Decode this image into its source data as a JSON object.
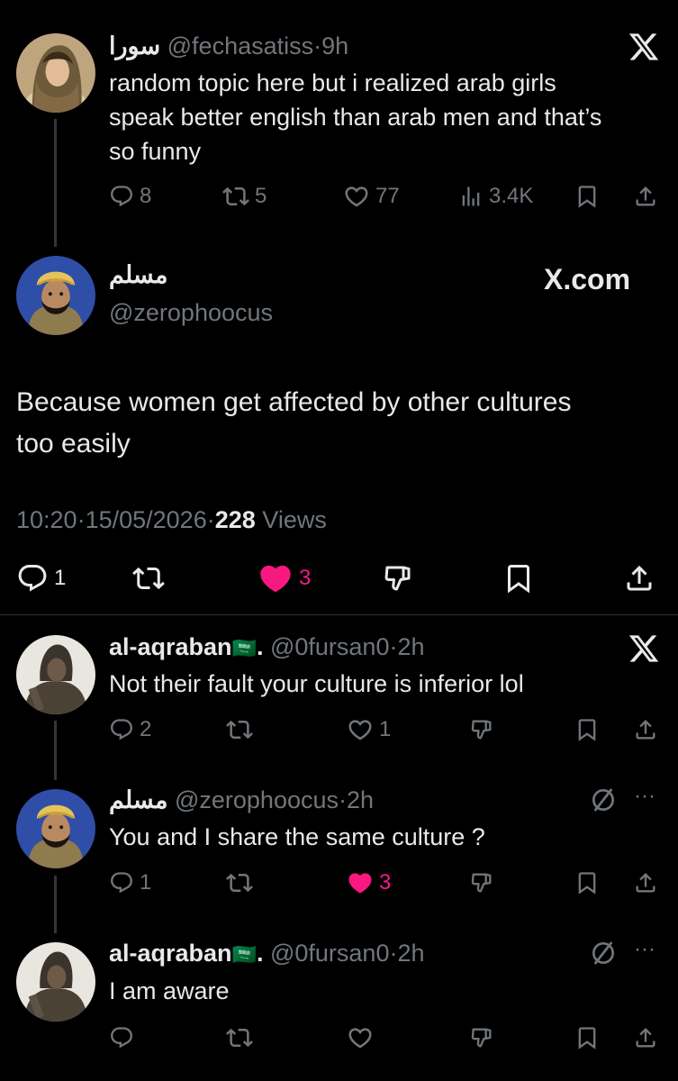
{
  "quoted": {
    "display_name": "سورا",
    "handle": "@fechasatiss",
    "separator": "·",
    "time": "9h",
    "text_lines": [
      "random topic here but i realized arab girls",
      "speak better english than arab men and that’s",
      "so funny"
    ],
    "replies": "8",
    "reposts": "5",
    "likes": "77",
    "views": "3.4K"
  },
  "main": {
    "display_name": "مسلم",
    "handle": "@zerophoocus",
    "source_label": "X.com",
    "text_lines": [
      "Because women get affected by other cultures",
      "too easily"
    ],
    "time": "10:20",
    "date": "15/05/2026",
    "views_count": "228",
    "views_label": "Views",
    "replies": "1",
    "likes": "3",
    "like_color": "#f91880"
  },
  "replies": [
    {
      "display_name": "al-aqraban",
      "flag": "🇸🇦",
      "name_suffix": ".",
      "handle": "@0fursan0",
      "time": "2h",
      "text": "Not their fault your culture is inferior lol",
      "replies": "2",
      "likes": "1"
    },
    {
      "display_name": "مسلم",
      "handle": "@zerophoocus",
      "time": "2h",
      "text": "You and I share the same culture ?",
      "replies": "1",
      "likes": "3"
    },
    {
      "display_name": "al-aqraban",
      "flag": "🇸🇦",
      "name_suffix": ".",
      "handle": "@0fursan0",
      "time": "2h",
      "text": "I am aware"
    }
  ],
  "more_label": "···",
  "icons": {
    "reply": "reply-icon",
    "repost": "repost-icon",
    "like": "heart-icon",
    "views": "views-icon",
    "bookmark": "bookmark-icon",
    "share": "share-icon",
    "dislike": "dislike-icon",
    "x_logo": "x-logo-icon",
    "hidden": "hide-icon"
  },
  "colors": {
    "background": "#000000",
    "text": "#e7e9ea",
    "muted": "#71767b",
    "like": "#f91880",
    "divider": "#2f3336"
  }
}
